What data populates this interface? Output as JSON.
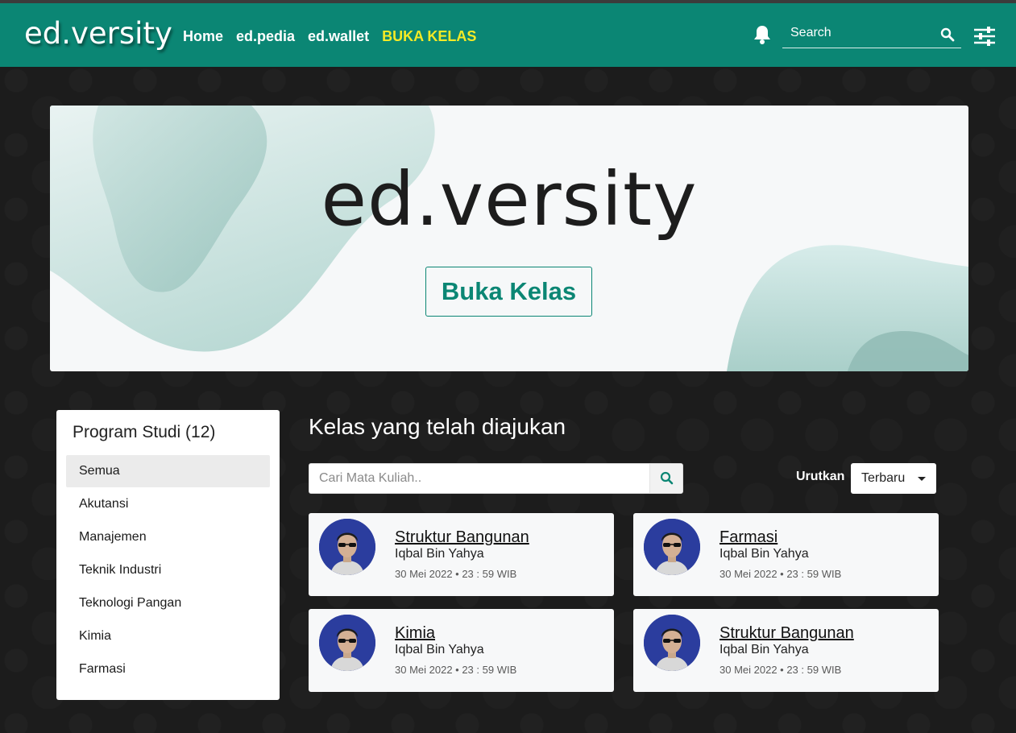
{
  "navbar": {
    "logo": "ed.versity",
    "links": [
      {
        "label": "Home"
      },
      {
        "label": "ed.pedia"
      },
      {
        "label": "ed.wallet"
      },
      {
        "label": "BUKA KELAS"
      }
    ],
    "search_placeholder": "Search",
    "icons": {
      "notification": "bell-icon",
      "search": "search-icon",
      "settings": "sliders-icon"
    }
  },
  "banner": {
    "title": "ed.versity",
    "button_label": "Buka Kelas"
  },
  "sidebar": {
    "title": "Program Studi (12)",
    "items": [
      {
        "label": "Semua",
        "active": true
      },
      {
        "label": "Akutansi"
      },
      {
        "label": "Manajemen"
      },
      {
        "label": "Teknik Industri"
      },
      {
        "label": "Teknologi Pangan"
      },
      {
        "label": "Kimia"
      },
      {
        "label": "Farmasi"
      }
    ]
  },
  "main": {
    "section_title": "Kelas yang telah diajukan",
    "search_placeholder": "Cari Mata Kuliah..",
    "sort_label": "Urutkan",
    "sort_value": "Terbaru",
    "courses": [
      {
        "title": "Struktur Bangunan",
        "author": "Iqbal Bin Yahya",
        "date": "30 Mei 2022 • 23 : 59 WIB"
      },
      {
        "title": "Farmasi",
        "author": "Iqbal Bin Yahya",
        "date": "30 Mei 2022 • 23 : 59 WIB"
      },
      {
        "title": "Kimia",
        "author": "Iqbal Bin Yahya",
        "date": "30 Mei 2022 • 23 : 59 WIB"
      },
      {
        "title": "Struktur Bangunan",
        "author": "Iqbal Bin Yahya",
        "date": "30 Mei 2022 • 23 : 59 WIB"
      }
    ]
  },
  "colors": {
    "primary": "#0b8674",
    "highlight": "#f4ea26",
    "background": "#1c1c1c"
  }
}
